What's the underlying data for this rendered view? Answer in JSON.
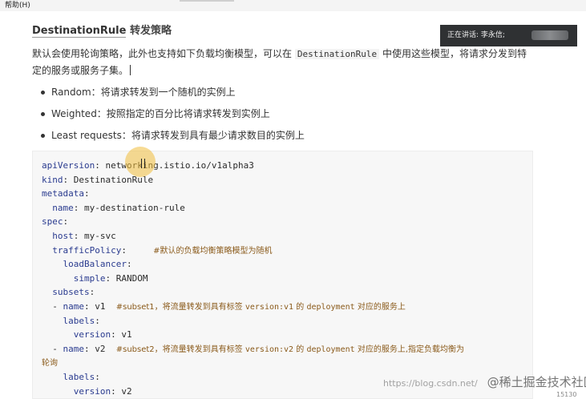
{
  "menubar": {
    "help": "帮助(H)"
  },
  "heading": {
    "code_word": "DestinationRule",
    "title_suffix": " 转发策略"
  },
  "paragraph": {
    "part1": "默认会使用轮询策略，此外也支持如下负载均衡模型，可以在 ",
    "code": "DestinationRule",
    "part2": " 中使用这些模型，将请求分发到特定的服务或服务子集。"
  },
  "bullets": [
    "Random：将请求转发到一个随机的实例上",
    "Weighted：按照指定的百分比将请求转发到实例上",
    "Least requests：将请求转发到具有最少请求数目的实例上"
  ],
  "code": {
    "l1_key": "apiVersion",
    "l1_val": ": networking.istio.io/v1alpha3",
    "l2_key": "kind",
    "l2_val": ": DestinationRule",
    "l3_key": "metadata",
    "l3_val": ":",
    "l4_indent": "  ",
    "l4_key": "name",
    "l4_val": ": my-destination-rule",
    "l5_key": "spec",
    "l5_val": ":",
    "l6_indent": "  ",
    "l6_key": "host",
    "l6_val": ": my-svc",
    "l7_indent": "  ",
    "l7_key": "trafficPolicy",
    "l7_val": ":     ",
    "l7_comment": "#默认的负载均衡策略模型为随机",
    "l8_indent": "    ",
    "l8_key": "loadBalancer",
    "l8_val": ":",
    "l9_indent": "      ",
    "l9_key": "simple",
    "l9_val": ": RANDOM",
    "l10_indent": "  ",
    "l10_key": "subsets",
    "l10_val": ":",
    "l11_indent": "  - ",
    "l11_key": "name",
    "l11_val": ": v1  ",
    "l11_c1": "#subset1，将流量转发到具有标签 ",
    "l11_c2": "version:v1",
    "l11_c3": " 的 ",
    "l11_c4": "deployment",
    "l11_c5": " 对应的服务上",
    "l12_indent": "    ",
    "l12_key": "labels",
    "l12_val": ":",
    "l13_indent": "      ",
    "l13_key": "version",
    "l13_val": ": v1",
    "l14_indent": "  - ",
    "l14_key": "name",
    "l14_val": ": v2  ",
    "l14_c1": "#subset2，将流量转发到具有标签 ",
    "l14_c2": "version:v2",
    "l14_c3": " 的 ",
    "l14_c4": "deployment",
    "l14_c5": " 对应的服务上,指定负载均衡为",
    "l15_comment": "轮询",
    "l16_indent": "    ",
    "l16_key": "labels",
    "l16_val": ":",
    "l17_indent": "      ",
    "l17_key": "version",
    "l17_val": ": v2"
  },
  "speaker": {
    "label": "正在讲话: 李永信;"
  },
  "watermark": {
    "url": "https://blog.csdn.net/",
    "brand": "@稀土掘金技术社区"
  },
  "corner": {
    "text": "15130"
  }
}
